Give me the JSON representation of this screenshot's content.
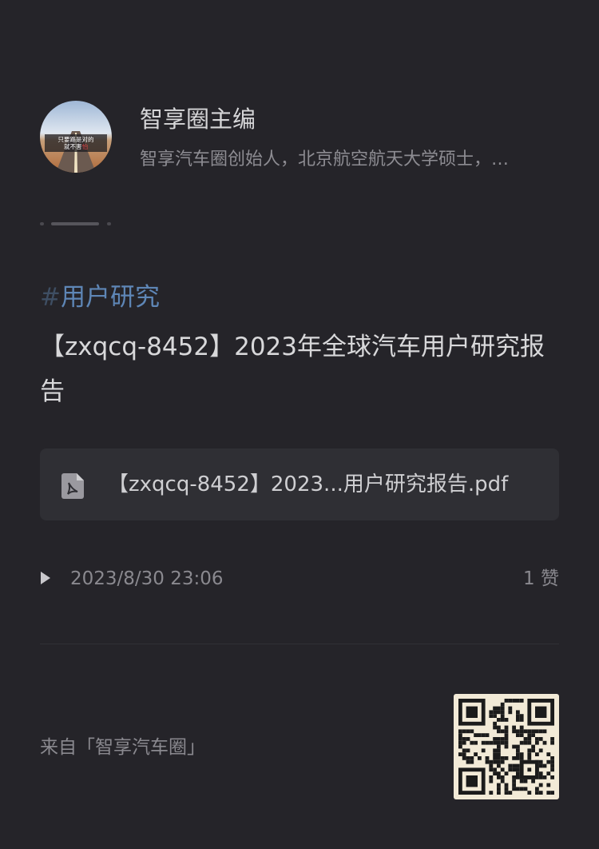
{
  "author": {
    "name": "智享圈主编",
    "bio": "智享汽车圈创始人，北京航空航天大学硕士，…",
    "avatar_text": "只要路是对的 就不害怕"
  },
  "post": {
    "tag_hash": "#",
    "tag": "用户研究",
    "title": "【zxqcq-8452】2023年全球汽车用户研究报告",
    "file": {
      "icon": "pdf-icon",
      "name": "【zxqcq-8452】2023...用户研究报告.pdf"
    },
    "timestamp": "2023/8/30 23:06",
    "likes": "1 赞"
  },
  "footer": {
    "source": "来自「智享汽车圈」",
    "qr_icon": "qr-code-icon"
  },
  "colors": {
    "background": "#252429",
    "tag": "#5e86b6",
    "card": "#2f2f34"
  }
}
